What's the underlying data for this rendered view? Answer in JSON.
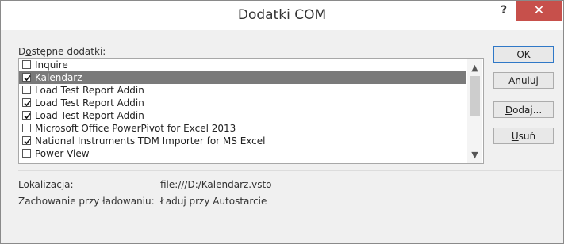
{
  "window": {
    "title": "Dodatki COM",
    "help_label": "?",
    "close_label": "✕"
  },
  "list": {
    "label_prefix": "D",
    "label_underlined": "o",
    "label_rest": "stępne dodatki:",
    "items": [
      {
        "label": "Inquire",
        "checked": false,
        "selected": false
      },
      {
        "label": "Kalendarz",
        "checked": true,
        "selected": true
      },
      {
        "label": "Load Test Report Addin",
        "checked": false,
        "selected": false
      },
      {
        "label": "Load Test Report Addin",
        "checked": true,
        "selected": false
      },
      {
        "label": "Load Test Report Addin",
        "checked": true,
        "selected": false
      },
      {
        "label": "Microsoft Office PowerPivot for Excel 2013",
        "checked": false,
        "selected": false
      },
      {
        "label": "National Instruments TDM Importer for MS Excel",
        "checked": true,
        "selected": false
      },
      {
        "label": "Power View",
        "checked": false,
        "selected": false
      }
    ],
    "scroll_up_icon": "▲",
    "scroll_down_icon": "▼"
  },
  "buttons": {
    "ok": "OK",
    "cancel": "Anuluj",
    "add_underlined": "D",
    "add_rest": "odaj...",
    "remove_underlined": "U",
    "remove_rest": "suń"
  },
  "details": {
    "location_label": "Lokalizacja:",
    "location_value": "file:///D:/Kalendarz.vsto",
    "load_label": "Zachowanie przy ładowaniu:",
    "load_value": "Ładuj przy Autostarcie"
  },
  "colors": {
    "close_button": "#c7504b",
    "selection": "#7a7a7a",
    "default_button_border": "#2f78c7"
  }
}
